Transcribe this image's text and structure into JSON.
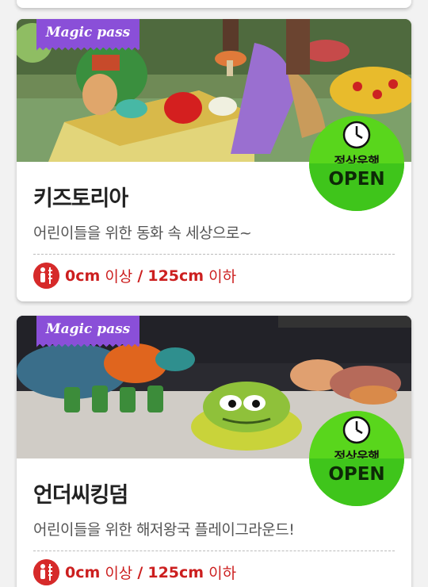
{
  "cards": [
    {
      "badge": "Magic pass",
      "status_kr": "정상운행",
      "status_en": "OPEN",
      "title": "키즈토리아",
      "description": "어린이들을 위한 동화 속 세상으로~",
      "height": {
        "min": "0cm",
        "min_suffix": "이상",
        "sep": "/",
        "max": "125cm",
        "max_suffix": "이하"
      }
    },
    {
      "badge": "Magic pass",
      "status_kr": "정상운행",
      "status_en": "OPEN",
      "title": "언더씨킹덤",
      "description": "어린이들을 위한 해저왕국 플레이그라운드!",
      "height": {
        "min": "0cm",
        "min_suffix": "이상",
        "sep": "/",
        "max": "125cm",
        "max_suffix": "이하"
      }
    }
  ],
  "colors": {
    "badge_purple": "#8a4fd8",
    "open_green": "#59d61c",
    "height_red": "#cc1f1f"
  },
  "icons": {
    "clock": "clock-icon",
    "height": "child-height-icon"
  }
}
